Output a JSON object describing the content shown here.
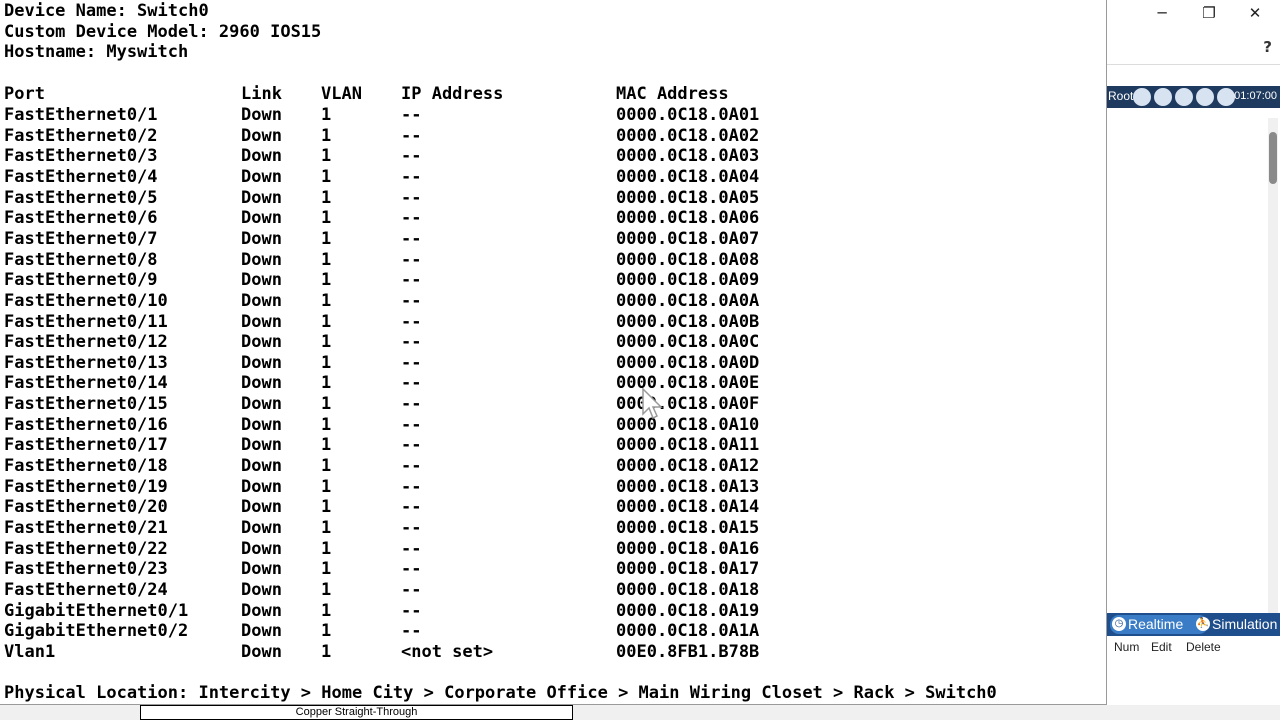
{
  "app": {
    "toolbar_root": "Root",
    "clock": "01:07:00",
    "help": "?",
    "minimize": "─",
    "restore": "❐",
    "close": "✕",
    "mode_realtime": "Realtime",
    "mode_simulation": "Simulation",
    "action_num": "Num",
    "action_edit": "Edit",
    "action_delete": "Delete",
    "cable_label": "Copper Straight-Through"
  },
  "device": {
    "name_line": "Device Name: Switch0",
    "model_line": "Custom Device Model: 2960 IOS15",
    "hostname_line": "Hostname: Myswitch"
  },
  "table": {
    "headers": {
      "port": "Port",
      "link": "Link",
      "vlan": "VLAN",
      "ip": "IP Address",
      "mac": "MAC Address"
    },
    "rows": [
      {
        "port": "FastEthernet0/1",
        "link": "Down",
        "vlan": "1",
        "ip": "--",
        "mac": "0000.0C18.0A01"
      },
      {
        "port": "FastEthernet0/2",
        "link": "Down",
        "vlan": "1",
        "ip": "--",
        "mac": "0000.0C18.0A02"
      },
      {
        "port": "FastEthernet0/3",
        "link": "Down",
        "vlan": "1",
        "ip": "--",
        "mac": "0000.0C18.0A03"
      },
      {
        "port": "FastEthernet0/4",
        "link": "Down",
        "vlan": "1",
        "ip": "--",
        "mac": "0000.0C18.0A04"
      },
      {
        "port": "FastEthernet0/5",
        "link": "Down",
        "vlan": "1",
        "ip": "--",
        "mac": "0000.0C18.0A05"
      },
      {
        "port": "FastEthernet0/6",
        "link": "Down",
        "vlan": "1",
        "ip": "--",
        "mac": "0000.0C18.0A06"
      },
      {
        "port": "FastEthernet0/7",
        "link": "Down",
        "vlan": "1",
        "ip": "--",
        "mac": "0000.0C18.0A07"
      },
      {
        "port": "FastEthernet0/8",
        "link": "Down",
        "vlan": "1",
        "ip": "--",
        "mac": "0000.0C18.0A08"
      },
      {
        "port": "FastEthernet0/9",
        "link": "Down",
        "vlan": "1",
        "ip": "--",
        "mac": "0000.0C18.0A09"
      },
      {
        "port": "FastEthernet0/10",
        "link": "Down",
        "vlan": "1",
        "ip": "--",
        "mac": "0000.0C18.0A0A"
      },
      {
        "port": "FastEthernet0/11",
        "link": "Down",
        "vlan": "1",
        "ip": "--",
        "mac": "0000.0C18.0A0B"
      },
      {
        "port": "FastEthernet0/12",
        "link": "Down",
        "vlan": "1",
        "ip": "--",
        "mac": "0000.0C18.0A0C"
      },
      {
        "port": "FastEthernet0/13",
        "link": "Down",
        "vlan": "1",
        "ip": "--",
        "mac": "0000.0C18.0A0D"
      },
      {
        "port": "FastEthernet0/14",
        "link": "Down",
        "vlan": "1",
        "ip": "--",
        "mac": "0000.0C18.0A0E"
      },
      {
        "port": "FastEthernet0/15",
        "link": "Down",
        "vlan": "1",
        "ip": "--",
        "mac": "0000.0C18.0A0F"
      },
      {
        "port": "FastEthernet0/16",
        "link": "Down",
        "vlan": "1",
        "ip": "--",
        "mac": "0000.0C18.0A10"
      },
      {
        "port": "FastEthernet0/17",
        "link": "Down",
        "vlan": "1",
        "ip": "--",
        "mac": "0000.0C18.0A11"
      },
      {
        "port": "FastEthernet0/18",
        "link": "Down",
        "vlan": "1",
        "ip": "--",
        "mac": "0000.0C18.0A12"
      },
      {
        "port": "FastEthernet0/19",
        "link": "Down",
        "vlan": "1",
        "ip": "--",
        "mac": "0000.0C18.0A13"
      },
      {
        "port": "FastEthernet0/20",
        "link": "Down",
        "vlan": "1",
        "ip": "--",
        "mac": "0000.0C18.0A14"
      },
      {
        "port": "FastEthernet0/21",
        "link": "Down",
        "vlan": "1",
        "ip": "--",
        "mac": "0000.0C18.0A15"
      },
      {
        "port": "FastEthernet0/22",
        "link": "Down",
        "vlan": "1",
        "ip": "--",
        "mac": "0000.0C18.0A16"
      },
      {
        "port": "FastEthernet0/23",
        "link": "Down",
        "vlan": "1",
        "ip": "--",
        "mac": "0000.0C18.0A17"
      },
      {
        "port": "FastEthernet0/24",
        "link": "Down",
        "vlan": "1",
        "ip": "--",
        "mac": "0000.0C18.0A18"
      },
      {
        "port": "GigabitEthernet0/1",
        "link": "Down",
        "vlan": "1",
        "ip": "--",
        "mac": "0000.0C18.0A19"
      },
      {
        "port": "GigabitEthernet0/2",
        "link": "Down",
        "vlan": "1",
        "ip": "--",
        "mac": "0000.0C18.0A1A"
      },
      {
        "port": "Vlan1",
        "link": "Down",
        "vlan": "1",
        "ip": "<not set>",
        "mac": "00E0.8FB1.B78B"
      }
    ]
  },
  "location_line": "Physical Location: Intercity > Home City > Corporate Office > Main Wiring Closet > Rack > Switch0"
}
